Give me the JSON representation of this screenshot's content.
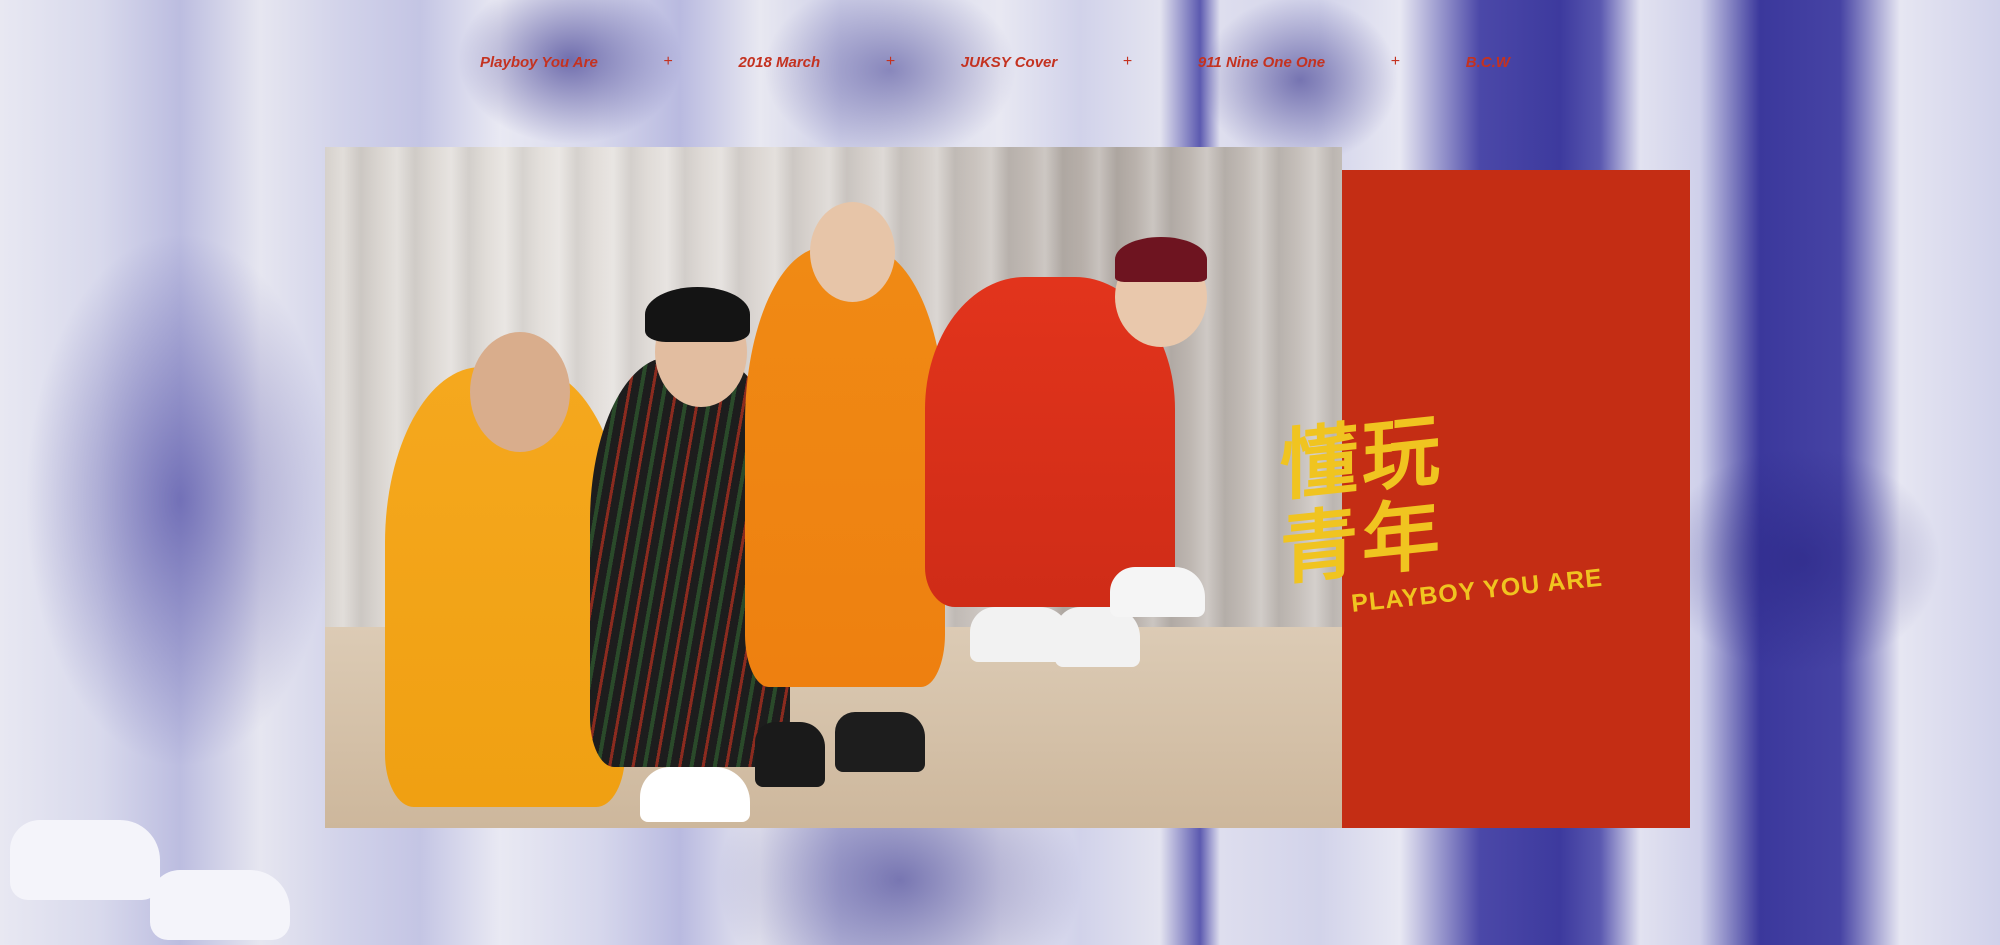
{
  "nav": {
    "items": [
      {
        "label": "Playboy You Are"
      },
      {
        "label": "2018 March"
      },
      {
        "label": "JUKSY Cover"
      },
      {
        "label": "911 Nine One One"
      },
      {
        "label": "B.C.W"
      }
    ],
    "separator": "+"
  },
  "hero": {
    "title_line1": "懂玩",
    "title_line2": "青年",
    "subtitle": "PLAYBOY YOU ARE"
  },
  "colors": {
    "accent_red": "#c42d14",
    "title_yellow": "#f0c420",
    "nav_text": "#c43220",
    "duotone_blue": "#3d3a9e"
  }
}
